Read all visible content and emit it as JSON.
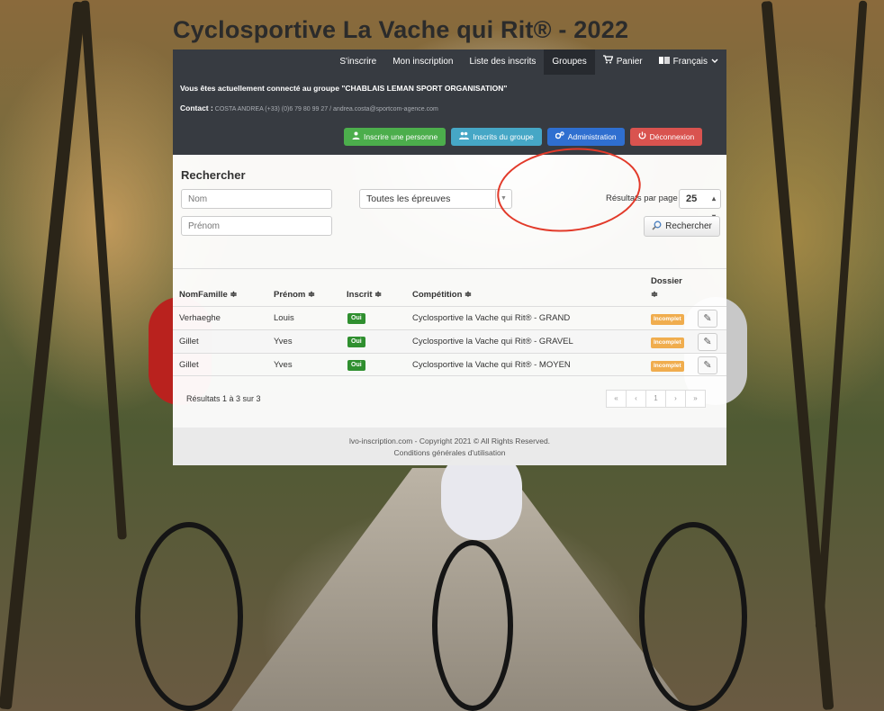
{
  "site_title": "Cyclosportive La Vache qui Rit® - 2022",
  "nav": {
    "register": "S'inscrire",
    "my_registration": "Mon inscription",
    "list": "Liste des inscrits",
    "groups": "Groupes",
    "cart": "Panier",
    "language": "Français"
  },
  "connected_text": "Vous êtes actuellement connecté au groupe \"CHABLAIS LEMAN SPORT ORGANISATION\"",
  "contact": {
    "label": "Contact :",
    "value": "COSTA ANDREA (+33) (0)6 79 80 99 27 / andrea.costa@sportcom-agence.com"
  },
  "actions": {
    "add_person": "Inscrire une personne",
    "group_members": "Inscrits du groupe",
    "admin": "Administration",
    "logout": "Déconnexion"
  },
  "search": {
    "title": "Rechercher",
    "nom_placeholder": "Nom",
    "prenom_placeholder": "Prénom",
    "epreuve_selected": "Toutes les épreuves",
    "per_page_label": "Résultats par page",
    "per_page_value": "25",
    "search_button": "Rechercher"
  },
  "table": {
    "headers": {
      "nom": "NomFamille ≑",
      "prenom": "Prénom ≑",
      "inscrit": "Inscrit ≑",
      "competition": "Compétition ≑",
      "dossier": "Dossier",
      "dossier_sort": "≑"
    },
    "rows": [
      {
        "nom": "Verhaeghe",
        "prenom": "Louis",
        "inscrit": "Oui",
        "competition": "Cyclosportive la Vache qui Rit® - GRAND",
        "dossier": "Incomplet"
      },
      {
        "nom": "Gillet",
        "prenom": "Yves",
        "inscrit": "Oui",
        "competition": "Cyclosportive la Vache qui Rit® - GRAVEL",
        "dossier": "Incomplet"
      },
      {
        "nom": "Gillet",
        "prenom": "Yves",
        "inscrit": "Oui",
        "competition": "Cyclosportive la Vache qui Rit® - MOYEN",
        "dossier": "Incomplet"
      }
    ],
    "results_text": "Résultats 1 à 3 sur 3",
    "pager": [
      "«",
      "‹",
      "1",
      "›",
      "»"
    ]
  },
  "footer": {
    "line1": "lvo-inscription.com - Copyright 2021 © All Rights Reserved.",
    "line2": "Conditions générales d'utilisation"
  },
  "icons": {
    "cart": "cart-icon",
    "language": "language-icon",
    "dropdown": "chevron-down-icon",
    "user": "user-icon",
    "users": "users-icon",
    "cogs": "cogs-icon",
    "power": "power-icon",
    "search": "search-icon",
    "edit": "pencil-icon"
  },
  "colors": {
    "topbar": "#373b41",
    "green": "#4cae4c",
    "blue": "#46a7c6",
    "navy": "#2f6fd0",
    "red": "#d9534f",
    "badge_oui": "#2f8f2f",
    "badge_incomplet": "#f0ad4e",
    "annotation": "#e23a2a"
  }
}
